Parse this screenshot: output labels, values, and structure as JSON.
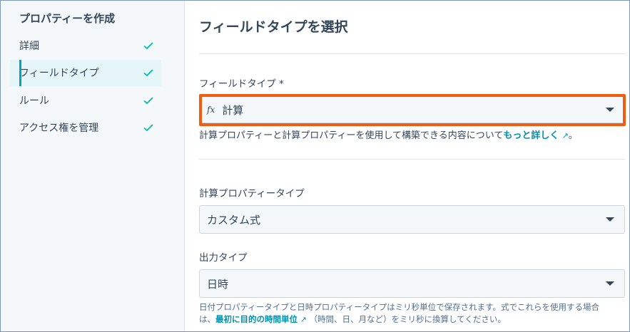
{
  "sidebar": {
    "title": "プロパティーを作成",
    "steps": [
      {
        "label": "詳細"
      },
      {
        "label": "フィールドタイプ"
      },
      {
        "label": "ルール"
      },
      {
        "label": "アクセス権を管理"
      }
    ]
  },
  "main": {
    "title": "フィールドタイプを選択",
    "field_type": {
      "label": "フィールドタイプ *",
      "icon_text": "fx",
      "value": "計算",
      "help_prefix": "計算プロパティーと計算プロパティーを使用して構築できる内容について",
      "help_link": "もっと詳しく",
      "help_suffix": "。"
    },
    "calc_type": {
      "label": "計算プロパティータイプ",
      "value": "カスタム式"
    },
    "output_type": {
      "label": "出力タイプ",
      "value": "日時",
      "help_line1": "日付プロパティータイプと日時プロパティータイプはミリ秒単位で保存されます。式でこれらを使用する場合",
      "help_line2_prefix": "は、",
      "help_link": "最初に目的の時間単位",
      "help_line2_suffix": "（時間、日、月など）をミリ秒に換算してください。"
    }
  },
  "colors": {
    "accent": "#00a4bd",
    "check": "#00bda5",
    "highlight": "#f25c0f",
    "link": "#0091ae"
  }
}
